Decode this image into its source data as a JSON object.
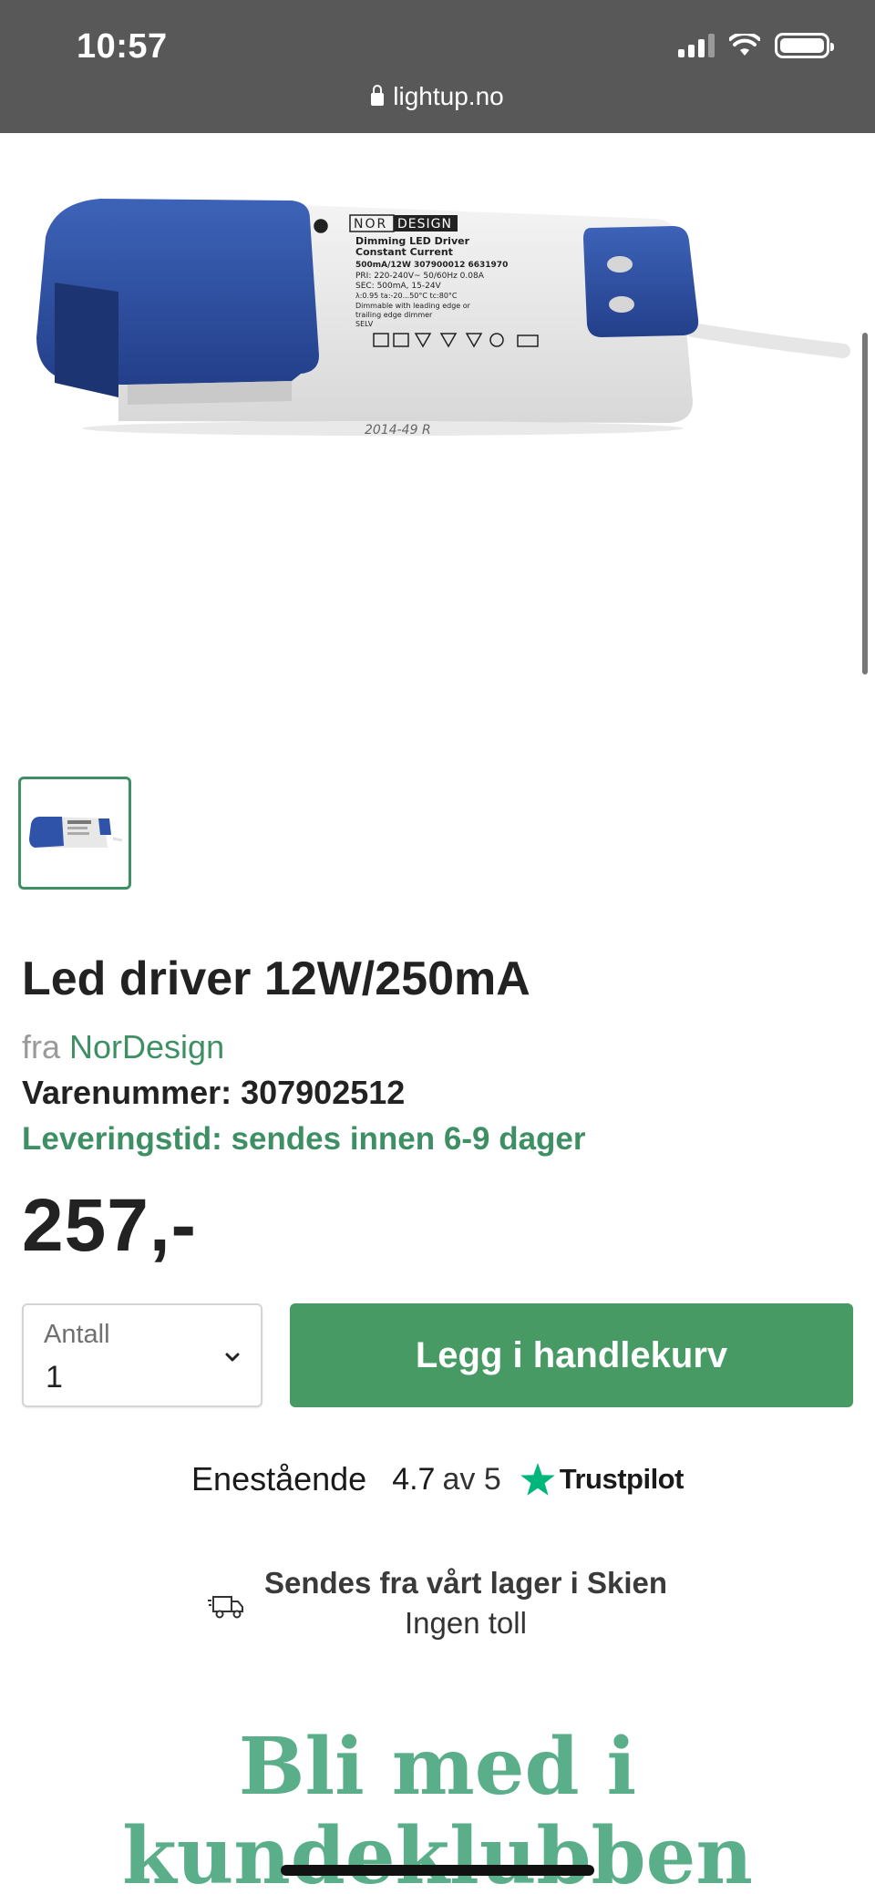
{
  "status_bar": {
    "time": "10:57",
    "url": "lightup.no"
  },
  "product": {
    "title": "Led driver 12W/250mA",
    "from_label": "fra",
    "brand": "NorDesign",
    "sku_label": "Varenummer: 307902512",
    "delivery": "Leveringstid: sendes innen 6-9 dager",
    "price": "257,-",
    "image": {
      "brand_prefix": "NOR",
      "brand_suffix": "DESIGN",
      "line1": "Dimming LED Driver",
      "line2": "Constant Current",
      "line3": "500mA/12W  307900012  6631970",
      "line4": "PRI: 220-240V~ 50/60Hz 0.08A",
      "line5": "SEC: 500mA, 15-24V",
      "line6": "λ:0.95  ta:-20...50°C  tc:80°C",
      "line7": "Dimmable with leading edge or",
      "line8": "trailing edge dimmer",
      "line9": "SELV",
      "stamp": "2014-49  R"
    }
  },
  "purchase": {
    "qty_label": "Antall",
    "qty_value": "1",
    "add_to_cart": "Legg i handlekurv"
  },
  "trustpilot": {
    "label": "Enestående",
    "score": "4.7",
    "out_of": "av 5",
    "brand": "Trustpilot",
    "star_color": "#00b67a"
  },
  "shipping": {
    "title": "Sendes fra vårt lager i Skien",
    "subtitle": "Ingen toll"
  },
  "club": {
    "heading": "Bli med i kundeklubben"
  },
  "colors": {
    "accent": "#479a63",
    "brand_text": "#3f8f64",
    "club": "#5aae8a"
  }
}
